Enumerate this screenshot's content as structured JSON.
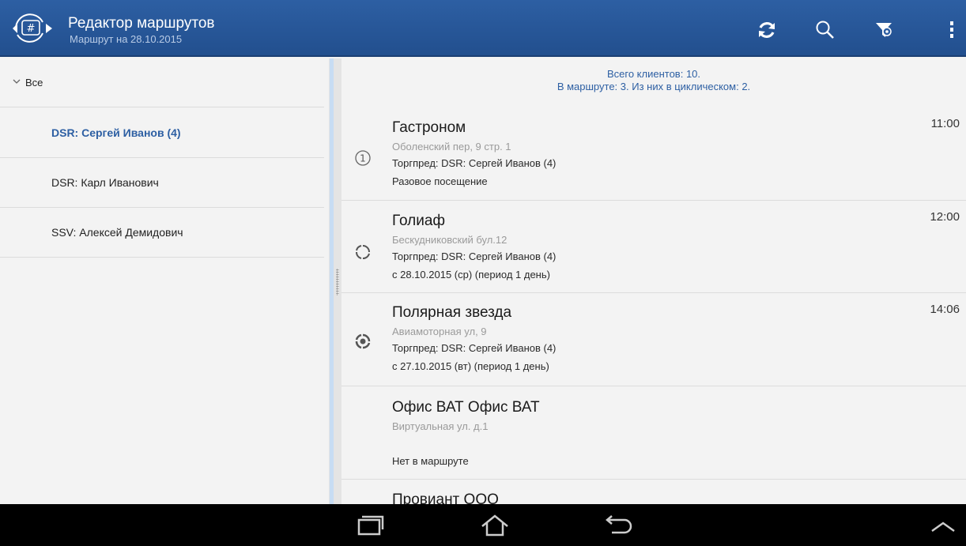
{
  "app": {
    "title": "Редактор маршрутов",
    "subtitle": "Маршрут на 28.10.2015",
    "accent_color": "#2d5fa3"
  },
  "toolbar": {
    "actions": [
      "refresh-icon",
      "search-icon",
      "filter-icon",
      "overflow-menu-icon"
    ]
  },
  "sidebar": {
    "items": [
      {
        "label": "Все",
        "icon": "chevron-down-icon"
      },
      {
        "label": "DSR: Сергей Иванов (4)",
        "selected": true
      },
      {
        "label": "DSR: Карл Иванович"
      },
      {
        "label": "SSV: Алексей Демидович"
      }
    ]
  },
  "summary": {
    "line1": "Всего клиентов: 10.",
    "line2": "В маршруте: 3. Из них в циклическом: 2."
  },
  "clients": [
    {
      "name": "Гастроном",
      "address": "Оболенский пер, 9 стр. 1",
      "rep": "Торгпред: DSR: Сергей Иванов (4)",
      "schedule": "Разовое посещение",
      "time": "11:00",
      "icon": "one-time-visit-icon"
    },
    {
      "name": "Голиаф",
      "address": "Бескудниковский бул.12",
      "rep": "Торгпред: DSR: Сергей Иванов (4)",
      "schedule": "с 28.10.2015 (ср) (период 1 день)",
      "time": "12:00",
      "icon": "cyclic-visit-icon"
    },
    {
      "name": "Полярная звезда",
      "address": "Авиамоторная ул, 9",
      "rep": "Торгпред: DSR: Сергей Иванов (4)",
      "schedule": "с 27.10.2015 (вт) (период 1 день)",
      "time": "14:06",
      "icon": "cyclic-active-visit-icon"
    },
    {
      "name": "Офис ВАТ Офис ВАТ",
      "address": "Виртуальная ул. д.1",
      "status": "Нет в маршруте"
    },
    {
      "name": "Провиант ООО"
    }
  ],
  "navbar": {
    "buttons": [
      "recent-apps-icon",
      "home-icon",
      "back-icon",
      "collapse-icon"
    ]
  }
}
